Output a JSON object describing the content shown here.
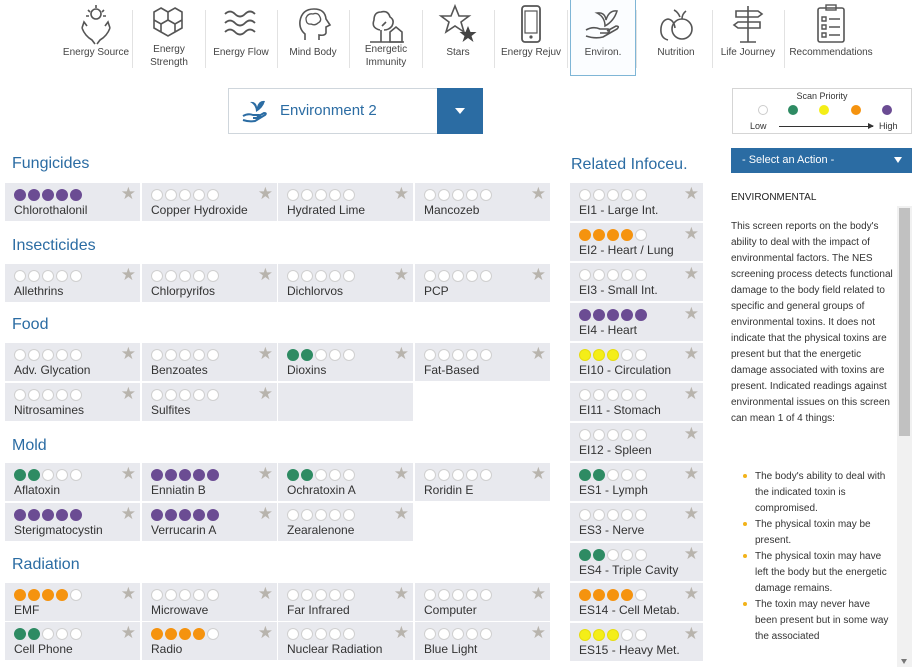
{
  "nav": {
    "items": [
      {
        "label": "Energy Source",
        "icon": "hands-sun-icon"
      },
      {
        "label": "Energy Strength",
        "icon": "hexagons-icon"
      },
      {
        "label": "Energy Flow",
        "icon": "waves-icon"
      },
      {
        "label": "Mind Body",
        "icon": "head-brain-icon"
      },
      {
        "label": "Energetic Immunity",
        "icon": "tree-house-icon"
      },
      {
        "label": "Stars",
        "icon": "stars-icon"
      },
      {
        "label": "Energy Rejuv",
        "icon": "phone-icon"
      },
      {
        "label": "Environ.",
        "icon": "hand-plant-icon",
        "active": true
      },
      {
        "label": "Nutrition",
        "icon": "fruit-icon"
      },
      {
        "label": "Life Journey",
        "icon": "signpost-icon"
      },
      {
        "label": "Recommendations",
        "icon": "clipboard-icon"
      }
    ]
  },
  "environment": {
    "label": "Environment 2"
  },
  "sections": [
    {
      "title": "Fungicides",
      "cells": [
        {
          "label": "Chlorothalonil",
          "dots": [
            "purple",
            "purple",
            "purple",
            "purple",
            "purple"
          ]
        },
        {
          "label": "Copper Hydroxide",
          "dots": [
            "",
            "",
            "",
            "",
            ""
          ]
        },
        {
          "label": "Hydrated Lime",
          "dots": [
            "",
            "",
            "",
            "",
            ""
          ]
        },
        {
          "label": "Mancozeb",
          "dots": [
            "",
            "",
            "",
            "",
            ""
          ]
        }
      ]
    },
    {
      "title": "Insecticides",
      "cells": [
        {
          "label": "Allethrins",
          "dots": [
            "",
            "",
            "",
            "",
            ""
          ]
        },
        {
          "label": "Chlorpyrifos",
          "dots": [
            "",
            "",
            "",
            "",
            ""
          ]
        },
        {
          "label": "Dichlorvos",
          "dots": [
            "",
            "",
            "",
            "",
            ""
          ]
        },
        {
          "label": "PCP",
          "dots": [
            "",
            "",
            "",
            "",
            ""
          ]
        }
      ]
    },
    {
      "title": "Food",
      "cells": [
        {
          "label": "Adv. Glycation",
          "dots": [
            "",
            "",
            "",
            "",
            ""
          ]
        },
        {
          "label": "Benzoates",
          "dots": [
            "",
            "",
            "",
            "",
            ""
          ]
        },
        {
          "label": "Dioxins",
          "dots": [
            "green",
            "green",
            "",
            "",
            ""
          ]
        },
        {
          "label": "Fat-Based",
          "dots": [
            "",
            "",
            "",
            "",
            ""
          ]
        },
        {
          "label": "Nitrosamines",
          "dots": [
            "",
            "",
            "",
            "",
            ""
          ]
        },
        {
          "label": "Sulfites",
          "dots": [
            "",
            "",
            "",
            "",
            ""
          ]
        },
        {
          "label": "",
          "dots": []
        }
      ]
    },
    {
      "title": "Mold",
      "cells": [
        {
          "label": "Aflatoxin",
          "dots": [
            "green",
            "green",
            "",
            "",
            ""
          ]
        },
        {
          "label": "Enniatin B",
          "dots": [
            "purple",
            "purple",
            "purple",
            "purple",
            "purple"
          ]
        },
        {
          "label": "Ochratoxin A",
          "dots": [
            "green",
            "green",
            "",
            "",
            ""
          ]
        },
        {
          "label": "Roridin E",
          "dots": [
            "",
            "",
            "",
            "",
            ""
          ]
        },
        {
          "label": "Sterigmatocystin",
          "dots": [
            "purple",
            "purple",
            "purple",
            "purple",
            "purple"
          ]
        },
        {
          "label": "Verrucarin A",
          "dots": [
            "purple",
            "purple",
            "purple",
            "purple",
            "purple"
          ]
        },
        {
          "label": "Zearalenone",
          "dots": [
            "",
            "",
            "",
            "",
            ""
          ]
        }
      ]
    },
    {
      "title": "Radiation",
      "cells": [
        {
          "label": "EMF",
          "dots": [
            "orange",
            "orange",
            "orange",
            "orange",
            ""
          ]
        },
        {
          "label": "Microwave",
          "dots": [
            "",
            "",
            "",
            "",
            ""
          ]
        },
        {
          "label": "Far Infrared",
          "dots": [
            "",
            "",
            "",
            "",
            ""
          ]
        },
        {
          "label": "Computer",
          "dots": [
            "",
            "",
            "",
            "",
            ""
          ]
        },
        {
          "label": "Cell Phone",
          "dots": [
            "green",
            "green",
            "",
            "",
            ""
          ]
        },
        {
          "label": "Radio",
          "dots": [
            "orange",
            "orange",
            "orange",
            "orange",
            ""
          ]
        },
        {
          "label": "Nuclear Radiation",
          "dots": [
            "",
            "",
            "",
            "",
            ""
          ]
        },
        {
          "label": "Blue Light",
          "dots": [
            "",
            "",
            "",
            "",
            ""
          ]
        }
      ]
    }
  ],
  "related": {
    "title": "Related Infoceu.",
    "cells": [
      {
        "label": "EI1 - Large Int.",
        "dots": [
          "",
          "",
          "",
          "",
          ""
        ]
      },
      {
        "label": "EI2 - Heart / Lung",
        "dots": [
          "orange",
          "orange",
          "orange",
          "orange",
          ""
        ]
      },
      {
        "label": "EI3 - Small Int.",
        "dots": [
          "",
          "",
          "",
          "",
          ""
        ]
      },
      {
        "label": "EI4 - Heart",
        "dots": [
          "purple",
          "purple",
          "purple",
          "purple",
          "purple"
        ]
      },
      {
        "label": "EI10 - Circulation",
        "dots": [
          "yellow",
          "yellow",
          "yellow",
          "",
          ""
        ]
      },
      {
        "label": "EI11 - Stomach",
        "dots": [
          "",
          "",
          "",
          "",
          ""
        ]
      },
      {
        "label": "EI12 - Spleen",
        "dots": [
          "",
          "",
          "",
          "",
          ""
        ]
      },
      {
        "label": "ES1 - Lymph",
        "dots": [
          "green",
          "green",
          "",
          "",
          ""
        ]
      },
      {
        "label": "ES3 - Nerve",
        "dots": [
          "",
          "",
          "",
          "",
          ""
        ]
      },
      {
        "label": "ES4 - Triple Cavity",
        "dots": [
          "green",
          "green",
          "",
          "",
          ""
        ]
      },
      {
        "label": "ES14 - Cell Metab.",
        "dots": [
          "orange",
          "orange",
          "orange",
          "orange",
          ""
        ]
      },
      {
        "label": "ES15 - Heavy Met.",
        "dots": [
          "yellow",
          "yellow",
          "yellow",
          "",
          ""
        ]
      }
    ]
  },
  "legend": {
    "title": "Scan Priority",
    "low": "Low",
    "high": "High",
    "colors": [
      "#ffffff",
      "#2e8b63",
      "#f4ee18",
      "#f5930f",
      "#6b4c93"
    ]
  },
  "action": {
    "label": "- Select an Action -"
  },
  "description": {
    "title": "ENVIRONMENTAL",
    "text": "This screen reports on the body's ability to deal with the impact of environmental factors. The NES screening process detects functional damage to the body field related to specific and general groups of environmental toxins. It does not indicate that the physical toxins are present but that the energetic damage associated with toxins are present. Indicated readings against environmental issues on this screen can mean 1 of 4 things:",
    "bullets": [
      "The body's ability to deal with the indicated toxin is compromised.",
      "The physical toxin may be present.",
      "The physical toxin may have left the body but the energetic damage remains.",
      "The toxin may never have been present but in some way the associated"
    ]
  },
  "colors": {
    "accent": "#2b6ca3",
    "cell_bg": "#e8e9ee",
    "star": "#b8b4ad"
  }
}
